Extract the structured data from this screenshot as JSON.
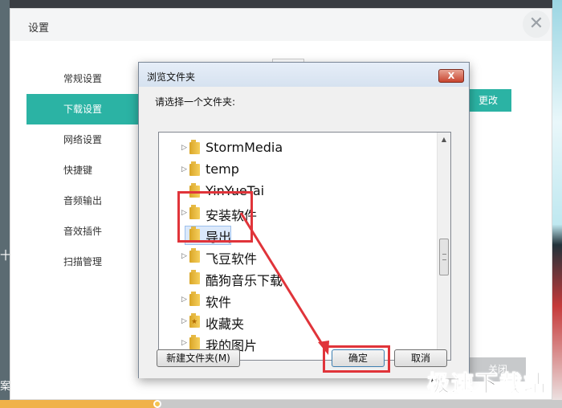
{
  "background": {
    "left_text_1": "十",
    "left_text_2": "案"
  },
  "settings": {
    "title": "设置",
    "close_symbol": "✕",
    "nav": [
      {
        "label": "常规设置",
        "active": false
      },
      {
        "label": "下载设置",
        "active": true
      },
      {
        "label": "网络设置",
        "active": false
      },
      {
        "label": "快捷键",
        "active": false
      },
      {
        "label": "音频输出",
        "active": false
      },
      {
        "label": "音效插件",
        "active": false
      },
      {
        "label": "扫描管理",
        "active": false
      }
    ],
    "change_label": "更改",
    "close_label": "关闭",
    "accent_color": "#2bb3a4"
  },
  "dialog": {
    "title": "浏览文件夹",
    "close_symbol": "X",
    "prompt": "请选择一个文件夹:",
    "tree": [
      {
        "label": "StormMedia",
        "expandable": true,
        "selected": false,
        "starred": false
      },
      {
        "label": "temp",
        "expandable": true,
        "selected": false,
        "starred": false
      },
      {
        "label": "YinYueTai",
        "expandable": false,
        "selected": false,
        "starred": false
      },
      {
        "label": "安装软件",
        "expandable": true,
        "selected": false,
        "starred": false
      },
      {
        "label": "导出",
        "expandable": false,
        "selected": true,
        "starred": false
      },
      {
        "label": "飞豆软件",
        "expandable": true,
        "selected": false,
        "starred": false
      },
      {
        "label": "酷狗音乐下载",
        "expandable": false,
        "selected": false,
        "starred": false
      },
      {
        "label": "软件",
        "expandable": true,
        "selected": false,
        "starred": false
      },
      {
        "label": "收藏夹",
        "expandable": true,
        "selected": false,
        "starred": true
      },
      {
        "label": "我的图片",
        "expandable": true,
        "selected": false,
        "starred": false
      }
    ],
    "new_folder_label": "新建文件夹(M)",
    "ok_label": "确定",
    "cancel_label": "取消",
    "annotation_color": "#e0343a"
  },
  "watermark": "极速下载站"
}
